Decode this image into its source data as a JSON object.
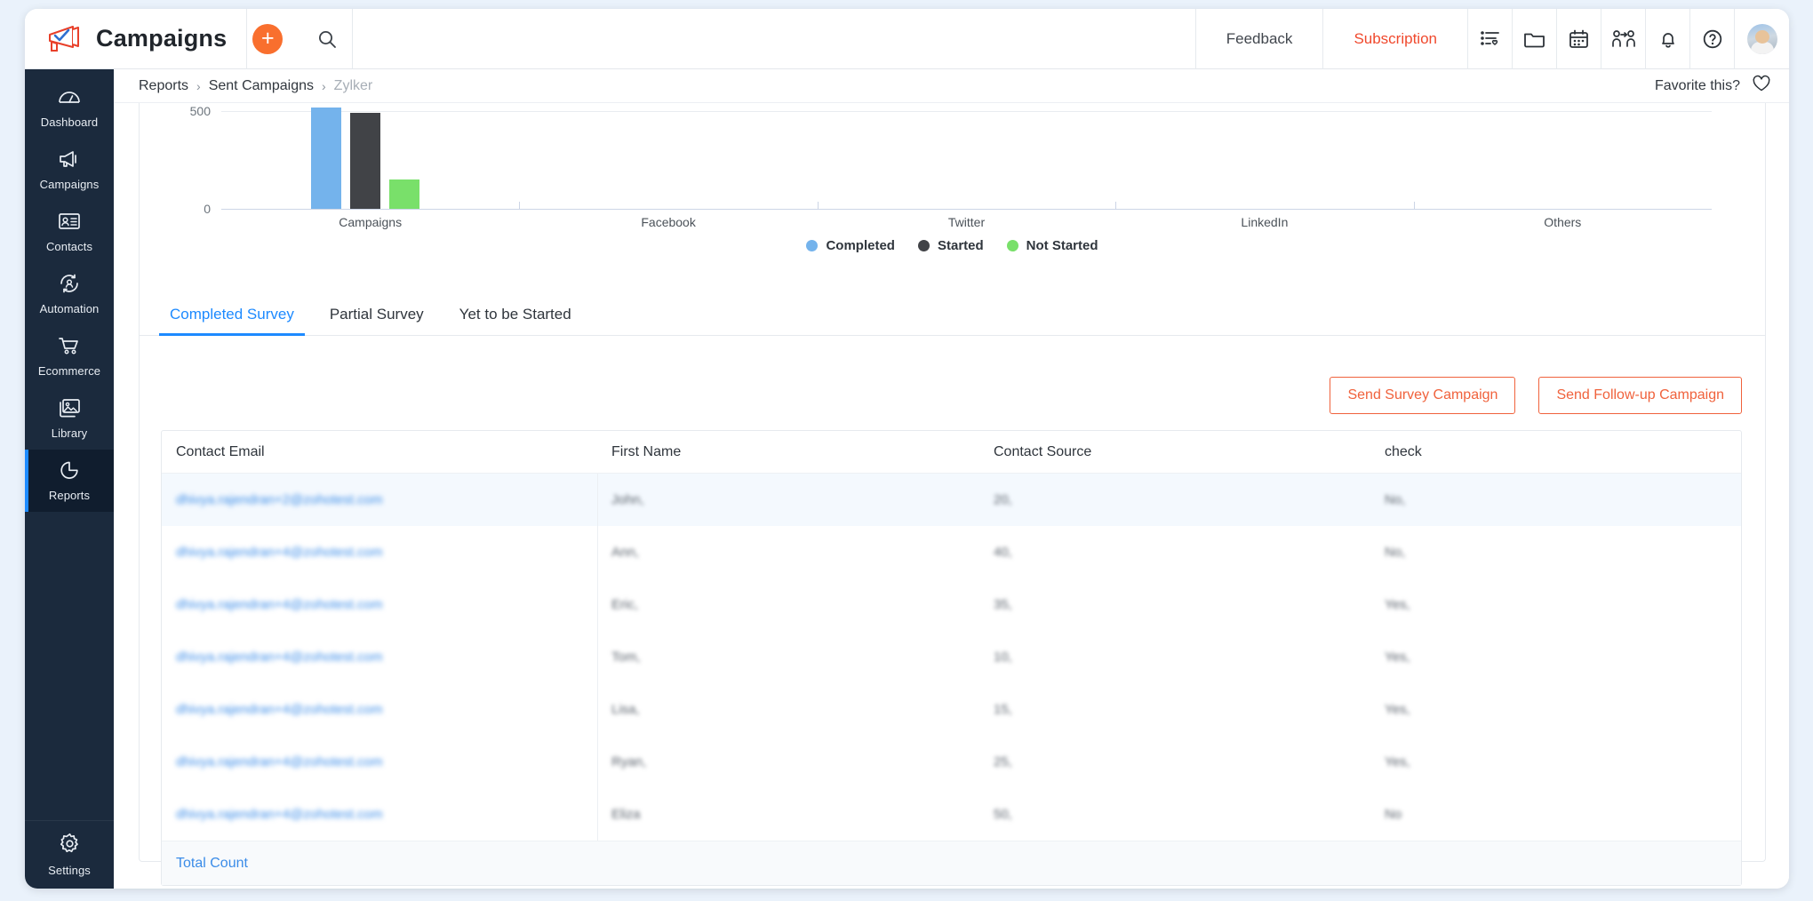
{
  "app": {
    "title": "Campaigns",
    "logo_icon": "megaphone-logo-icon",
    "add_label": "+",
    "search_icon": "search-icon"
  },
  "topbar": {
    "feedback_label": "Feedback",
    "subscription_label": "Subscription",
    "subscription_color": "#f0492d",
    "icons": [
      {
        "name": "list-favorite-icon"
      },
      {
        "name": "folder-icon"
      },
      {
        "name": "calendar-icon"
      },
      {
        "name": "invite-users-icon"
      },
      {
        "name": "bell-icon"
      },
      {
        "name": "help-icon"
      }
    ],
    "avatar_name": "user-avatar"
  },
  "sidebar": {
    "items": [
      {
        "label": "Dashboard",
        "icon": "dashboard-gauge-icon",
        "active": false
      },
      {
        "label": "Campaigns",
        "icon": "megaphone-icon",
        "active": false
      },
      {
        "label": "Contacts",
        "icon": "contact-card-icon",
        "active": false
      },
      {
        "label": "Automation",
        "icon": "automation-icon",
        "active": false
      },
      {
        "label": "Ecommerce",
        "icon": "cart-icon",
        "active": false
      },
      {
        "label": "Library",
        "icon": "image-library-icon",
        "active": false
      },
      {
        "label": "Reports",
        "icon": "pie-chart-icon",
        "active": true
      }
    ],
    "bottom": {
      "label": "Settings",
      "icon": "gear-icon"
    },
    "active_accent": "#1d8aff"
  },
  "breadcrumb": {
    "items": [
      "Reports",
      "Sent Campaigns",
      "Zylker"
    ],
    "separator": "›",
    "favorite_label": "Favorite this?",
    "favorite_icon": "heart-icon"
  },
  "chart_data": {
    "type": "bar",
    "title": "",
    "xlabel": "",
    "ylabel": "",
    "ylim": [
      0,
      560
    ],
    "yticks": [
      0,
      500
    ],
    "ytick_labels": [
      "0",
      "500"
    ],
    "grid": true,
    "legend_position": "bottom",
    "categories": [
      "Campaigns",
      "Facebook",
      "Twitter",
      "LinkedIn",
      "Others"
    ],
    "series": [
      {
        "name": "Completed",
        "color": "#74b3ec",
        "values": [
          520,
          0,
          0,
          0,
          0
        ]
      },
      {
        "name": "Started",
        "color": "#414347",
        "values": [
          495,
          0,
          0,
          0,
          0
        ]
      },
      {
        "name": "Not Started",
        "color": "#79e06a",
        "values": [
          150,
          0,
          0,
          0,
          0
        ]
      }
    ]
  },
  "tabs": [
    {
      "label": "Completed Survey",
      "active": true
    },
    {
      "label": "Partial Survey",
      "active": false
    },
    {
      "label": "Yet to be Started",
      "active": false
    }
  ],
  "actions": {
    "send_survey_label": "Send Survey Campaign",
    "send_followup_label": "Send Follow-up Campaign",
    "accent": "#f0623c"
  },
  "table": {
    "columns": [
      "Contact Email",
      "First Name",
      "Contact Source",
      "check"
    ],
    "rows": [
      {
        "email": "dhivya.rajendran+2@zohotest.com",
        "name": "John,",
        "source": "20,",
        "check": "No,"
      },
      {
        "email": "dhivya.rajendran+4@zohotest.com",
        "name": "Ann,",
        "source": "40,",
        "check": "No,"
      },
      {
        "email": "dhivya.rajendran+4@zohotest.com",
        "name": "Eric,",
        "source": "35,",
        "check": "Yes,"
      },
      {
        "email": "dhivya.rajendran+4@zohotest.com",
        "name": "Tom,",
        "source": "10,",
        "check": "Yes,"
      },
      {
        "email": "dhivya.rajendran+4@zohotest.com",
        "name": "Lisa,",
        "source": "15,",
        "check": "Yes,"
      },
      {
        "email": "dhivya.rajendran+4@zohotest.com",
        "name": "Ryan,",
        "source": "25,",
        "check": "Yes,"
      },
      {
        "email": "dhivya.rajendran+4@zohotest.com",
        "name": "Eliza",
        "source": "50,",
        "check": "No"
      }
    ],
    "footer_label": "Total Count"
  }
}
